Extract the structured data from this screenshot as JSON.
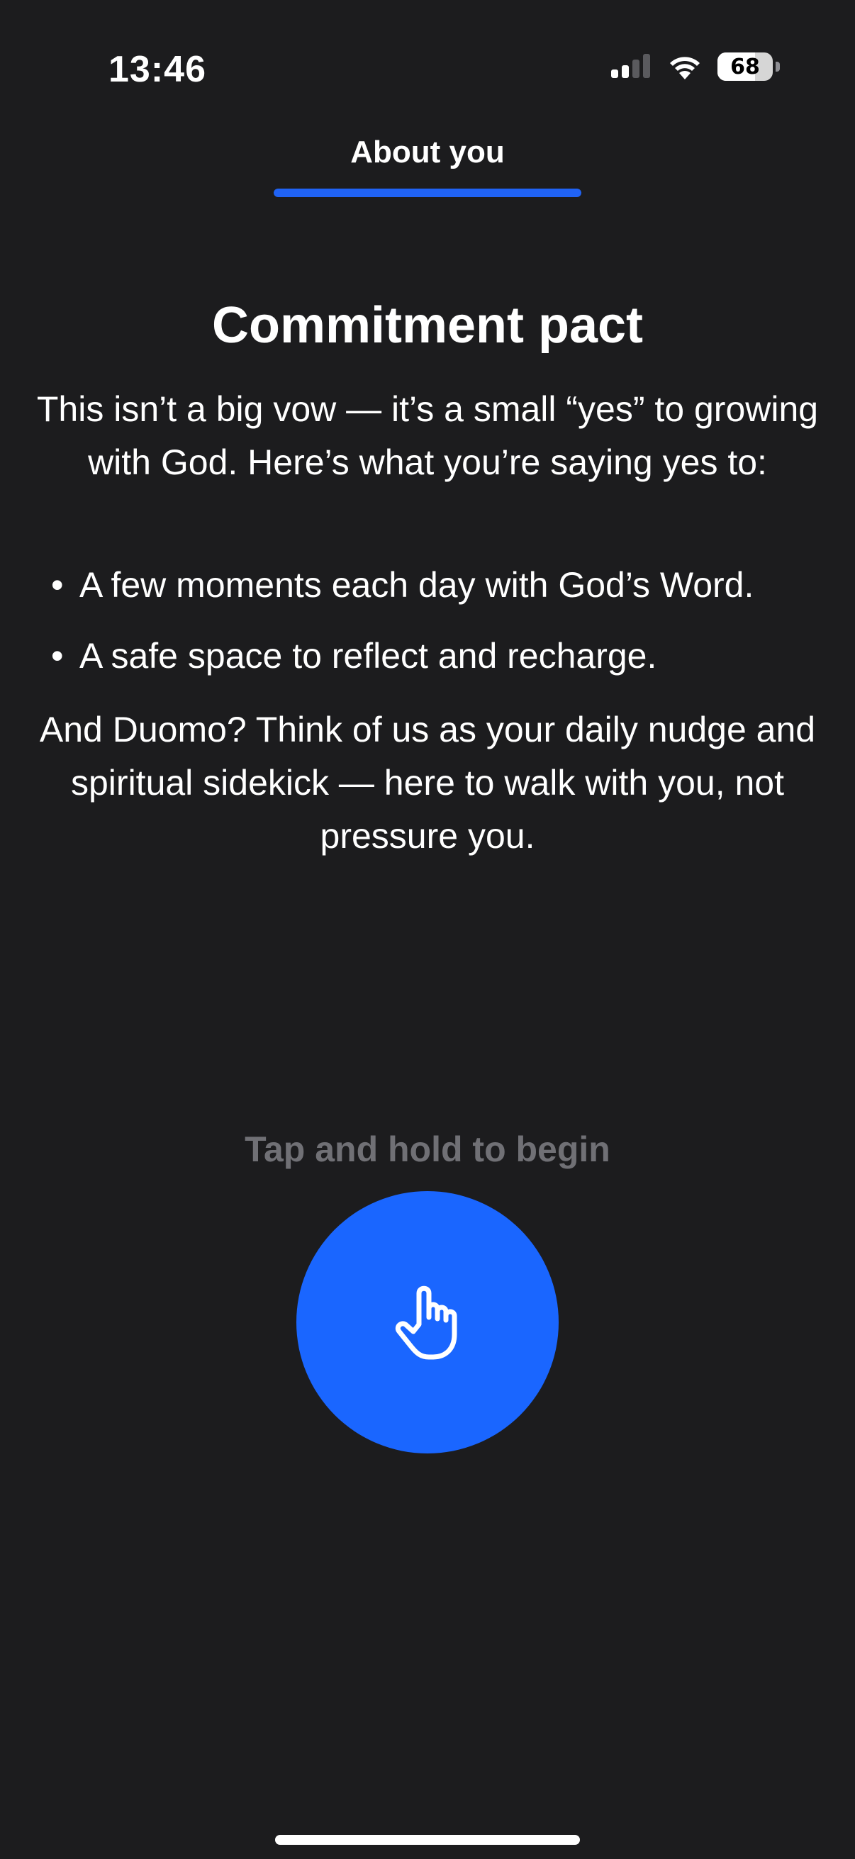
{
  "status_bar": {
    "time": "13:46",
    "battery_level": "68",
    "battery_fraction": 0.68
  },
  "header": {
    "title": "About you",
    "progress_fraction": 1.0
  },
  "content": {
    "title": "Commitment pact",
    "intro": "This isn’t a big vow — it’s a small “yes” to growing with God. Here’s what you’re saying yes to:",
    "bullets": [
      "A few moments each day with God’s Word.",
      "A safe space to reflect and recharge."
    ],
    "outro": "And Duomo? Think of us as your daily nudge and spiritual sidekick — here to walk with you, not pressure you."
  },
  "cta": {
    "hint": "Tap and hold to begin",
    "icon": "hand-pointer-icon"
  },
  "colors": {
    "background": "#1c1c1e",
    "accent": "#1a66ff",
    "hint_text": "#707075"
  }
}
